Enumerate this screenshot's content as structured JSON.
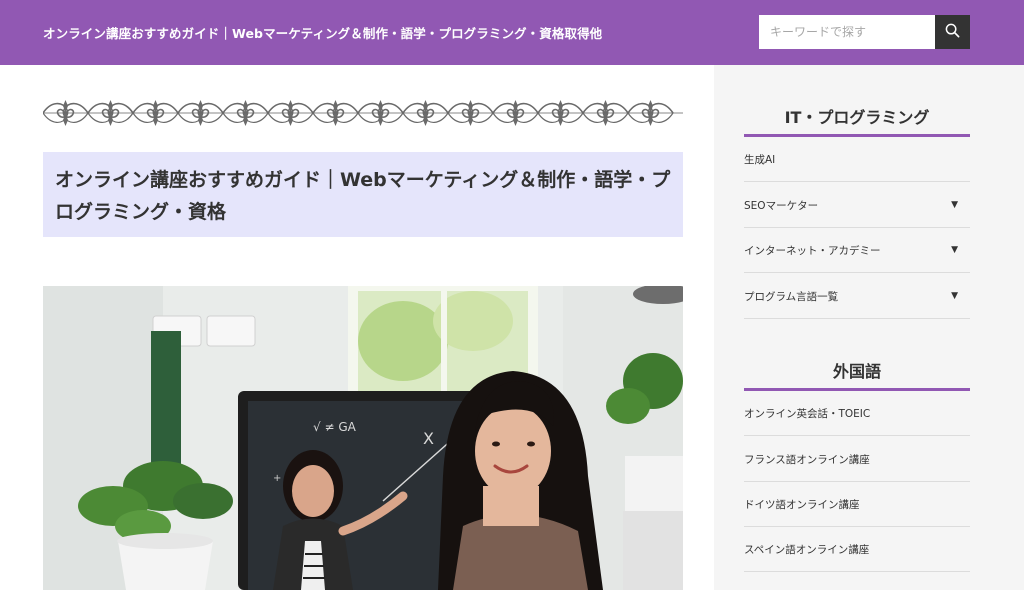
{
  "header": {
    "site_title": "オンライン講座おすすめガイド｜Webマーケティング＆制作・語学・プログラミング・資格取得他",
    "search_placeholder": "キーワードで探す",
    "search_icon": "magnifier-icon"
  },
  "main": {
    "page_title": "オンライン講座おすすめガイド｜Webマーケティング＆制作・語学・プログラミング・資格",
    "hero_image": "girl-at-computer-online-class"
  },
  "sidebar": {
    "sections": [
      {
        "title": "IT・プログラミング",
        "items": [
          {
            "label": "生成AI",
            "has_submenu": false
          },
          {
            "label": "SEOマーケター",
            "has_submenu": true
          },
          {
            "label": "インターネット・アカデミー",
            "has_submenu": true
          },
          {
            "label": "プログラム言語一覧",
            "has_submenu": true
          }
        ]
      },
      {
        "title": "外国語",
        "items": [
          {
            "label": "オンライン英会話・TOEIC",
            "has_submenu": false
          },
          {
            "label": "フランス語オンライン講座",
            "has_submenu": false
          },
          {
            "label": "ドイツ語オンライン講座",
            "has_submenu": false
          },
          {
            "label": "スペイン語オンライン講座",
            "has_submenu": false
          }
        ]
      }
    ],
    "submenu_arrow": "▼"
  },
  "colors": {
    "accent": "#9158b3",
    "title_bg": "#e5e5fb",
    "sidebar_bg": "#f5f5f5",
    "search_button": "#333333"
  }
}
